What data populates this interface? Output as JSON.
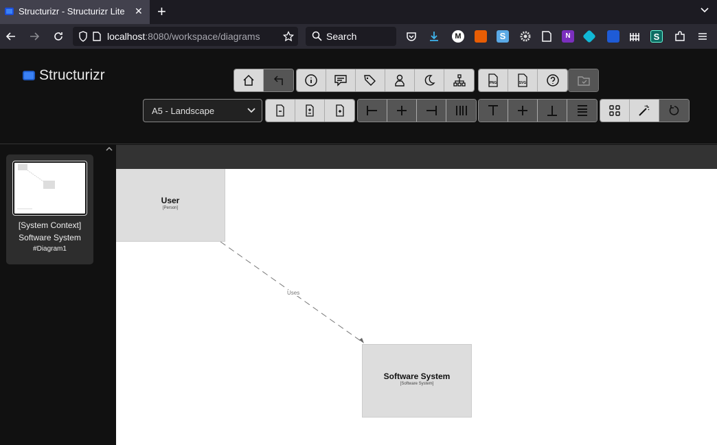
{
  "browser": {
    "tab_title": "Structurizr - Structurizr Lite",
    "close_glyph": "✕",
    "new_tab_glyph": "+",
    "url_host": "localhost",
    "url_rest": ":8080/workspace/diagrams",
    "search_placeholder": "Search",
    "extensions": [
      "pocket-icon",
      "download-icon",
      "m-icon",
      "sun-icon",
      "s-icon",
      "gear-icon",
      "file-icon",
      "onenote-icon",
      "box-icon",
      "shield-icon",
      "fence-icon",
      "s2-icon",
      "puzzle-icon",
      "menu-icon"
    ]
  },
  "app": {
    "logo_text": "Structurizr",
    "page_size": "A5 - Landscape",
    "toolbar_row1": {
      "group1": [
        "home-icon",
        "back-arrow-icon"
      ],
      "group2": [
        "info-icon",
        "comment-icon",
        "tags-icon",
        "person-icon",
        "moon-icon",
        "hierarchy-icon"
      ],
      "group3": [
        "png-export-icon",
        "svg-export-icon",
        "help-icon"
      ],
      "group4": [
        "folder-icon"
      ]
    },
    "toolbar_labels": {
      "png": "PNG",
      "svg": "SVG"
    }
  },
  "sidebar": {
    "diagram_title_line1": "[System Context]",
    "diagram_title_line2": "Software System",
    "diagram_key": "#Diagram1"
  },
  "diagram": {
    "user": {
      "name": "User",
      "type": "[Person]"
    },
    "system": {
      "name": "Software System",
      "type": "[Software System]"
    },
    "relationship_label": "Uses"
  }
}
